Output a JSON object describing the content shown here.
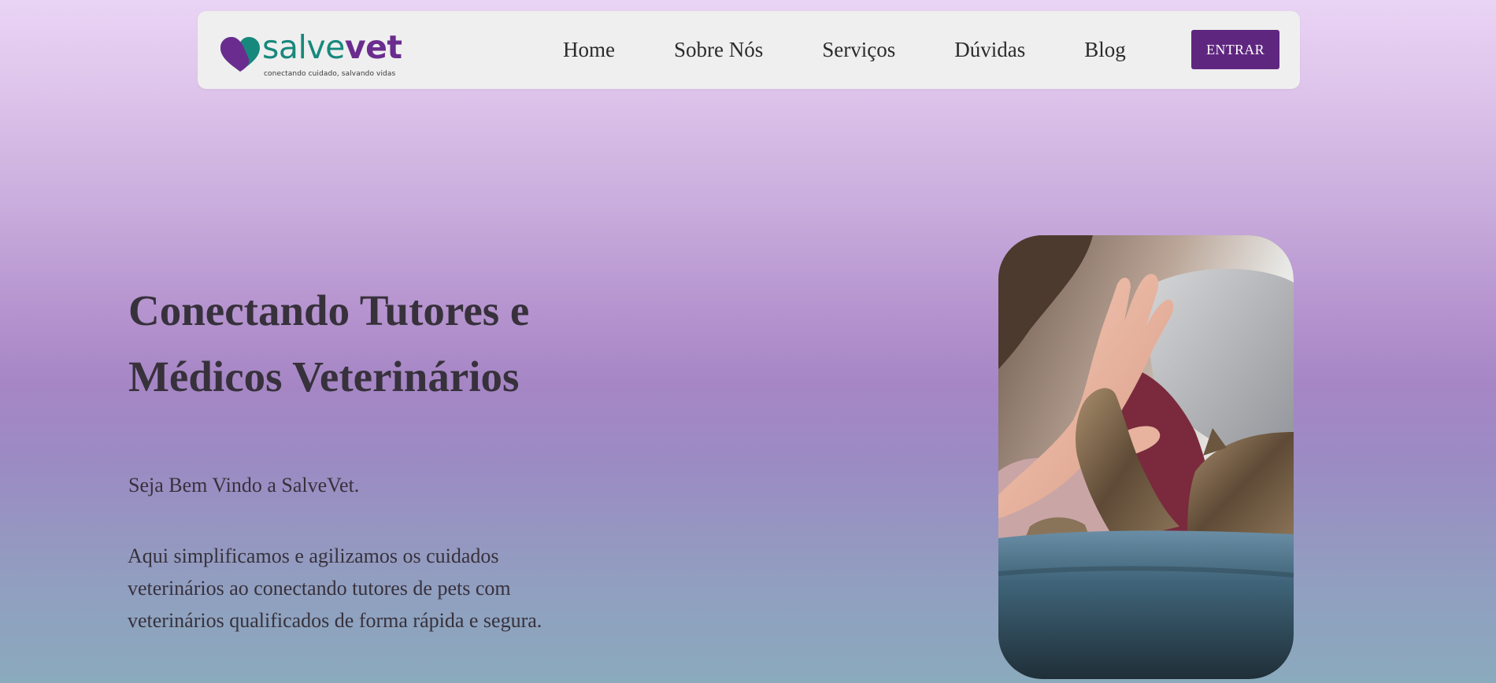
{
  "brand": {
    "name_part1": "salve",
    "name_part2": "vet",
    "tagline": "conectando cuidado, salvando vidas",
    "colors": {
      "primary_purple": "#5f2680",
      "logo_teal": "#17887c",
      "logo_purple": "#6a2c8e"
    }
  },
  "nav": {
    "items": [
      {
        "label": "Home"
      },
      {
        "label": "Sobre Nós"
      },
      {
        "label": "Serviços"
      },
      {
        "label": "Dúvidas"
      },
      {
        "label": "Blog"
      }
    ],
    "login_label": "ENTRAR"
  },
  "hero": {
    "title_line1": "Conectando Tutores e",
    "title_line2": "Médicos Veterinários",
    "welcome": "Seja Bem Vindo a SalveVet.",
    "description": "Aqui simplificamos e agilizamos os cuidados veterinários ao conectando tutores de pets com veterinários qualificados de forma rápida e segura.",
    "image_icon": "hand-and-cat-paw-high-five-photo"
  }
}
